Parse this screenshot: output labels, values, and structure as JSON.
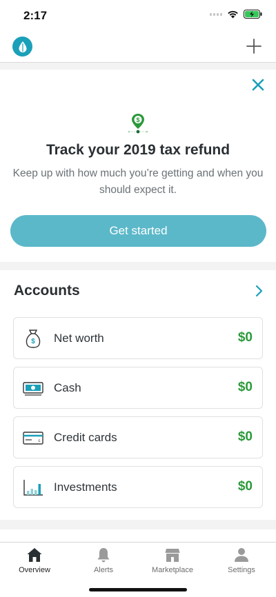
{
  "status_bar": {
    "time": "2:17"
  },
  "icons": {
    "logo": "drop-logo-icon",
    "add": "plus-icon",
    "close": "close-icon",
    "refund": "location-pin-dollar-icon",
    "accounts_chevron": "chevron-right-icon",
    "net_worth": "money-bag-icon",
    "cash": "banknote-icon",
    "credit_cards": "credit-card-icon",
    "investments": "bar-chart-icon",
    "overview": "home-icon",
    "alerts": "bell-icon",
    "marketplace": "storefront-icon",
    "settings": "user-icon"
  },
  "colors": {
    "accent": "#1aa0b8",
    "cta": "#5bb8c9",
    "positive": "#2b9a3a",
    "pin": "#2b9a3a"
  },
  "promo": {
    "title": "Track your 2019 tax refund",
    "description": "Keep up with how much you’re getting and when you should expect it.",
    "cta_label": "Get started"
  },
  "accounts": {
    "title": "Accounts",
    "items": [
      {
        "label": "Net worth",
        "value": "$0"
      },
      {
        "label": "Cash",
        "value": "$0"
      },
      {
        "label": "Credit cards",
        "value": "$0"
      },
      {
        "label": "Investments",
        "value": "$0"
      }
    ]
  },
  "tab_bar": {
    "tabs": [
      {
        "label": "Overview"
      },
      {
        "label": "Alerts"
      },
      {
        "label": "Marketplace"
      },
      {
        "label": "Settings"
      }
    ],
    "active": "Overview"
  }
}
